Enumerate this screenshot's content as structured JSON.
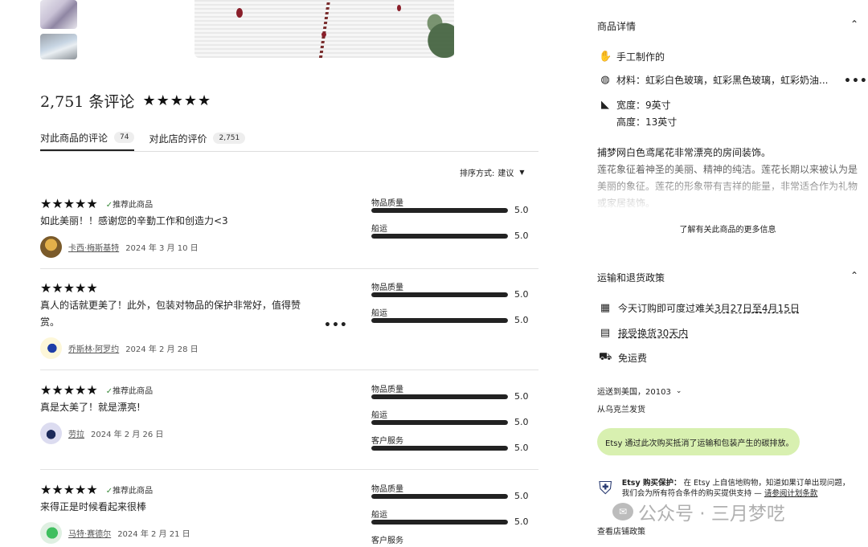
{
  "reviews_header": {
    "count_label": "2,751 条评论",
    "stars": "★★★★★"
  },
  "tabs": [
    {
      "label": "对此商品的评论",
      "count": "74"
    },
    {
      "label": "对此店的评价",
      "count": "2,751"
    }
  ],
  "sort": {
    "label": "排序方式:",
    "value": "建议"
  },
  "rating_labels": {
    "quality": "物品质量",
    "shipping": "船运",
    "service": "客户服务"
  },
  "reviews": [
    {
      "stars": "★★★★★",
      "recommended": "推荐此商品",
      "text": "如此美丽！！感谢您的辛勤工作和创造力<3",
      "author": "卡西·梅斯基特",
      "date": "2024 年 3 月 10 日",
      "ratings": [
        {
          "value": "5.0",
          "fill": 1.0
        },
        {
          "value": "5.0",
          "fill": 1.0
        }
      ]
    },
    {
      "stars": "★★★★★",
      "recommended": "",
      "text": "真人的话就更美了！此外，包装对物品的保护非常好，值得赞赏。",
      "author": "乔斯林·阿罗约",
      "date": "2024 年 2 月 28 日",
      "ratings": [
        {
          "value": "5.0",
          "fill": 1.0
        },
        {
          "value": "5.0",
          "fill": 1.0
        }
      ]
    },
    {
      "stars": "★★★★★",
      "recommended": "推荐此商品",
      "text": "真是太美了！就是漂亮!",
      "author": "劳拉",
      "date": "2024 年 2 月 26 日",
      "ratings": [
        {
          "value": "5.0",
          "fill": 1.0
        },
        {
          "value": "5.0",
          "fill": 1.0
        },
        {
          "value": "5.0",
          "fill": 1.0
        }
      ]
    },
    {
      "stars": "★★★★★",
      "recommended": "推荐此商品",
      "text": "来得正是时候看起来很棒",
      "author": "马特·赛德尔",
      "date": "2024 年 2 月 21 日",
      "ratings": [
        {
          "value": "5.0",
          "fill": 1.0
        },
        {
          "value": "5.0",
          "fill": 1.0
        }
      ]
    }
  ],
  "details": {
    "title": "商品详情",
    "handmade": "手工制作的",
    "materials": "材料：虹彩白色玻璃，虹彩黑色玻璃，虹彩奶油...",
    "width": "宽度：9英寸",
    "height": "高度：13英寸",
    "desc_line1": "捕梦网白色鸢尾花非常漂亮的房间装饰。",
    "desc_line2": "莲花象征着神圣的美丽、精神的纯洁。莲花长期以来被认为是美丽的象征。莲花的形象带有吉祥的能量，非常适合作为礼物或家居装饰。",
    "learn_more": "了解有关此商品的更多信息"
  },
  "shipping": {
    "title": "运输和退货政策",
    "delivery_prefix": "今天订购即可度过难关",
    "delivery_range": "3月27日至4月15日",
    "returns": "接受换货30天内",
    "free_shipping": "免运费",
    "ship_to": "运送到美国，20103",
    "ships_from": "从乌克兰发货",
    "eco": "Etsy 通过此次购买抵消了运输和包装产生的碳排放。",
    "protection_title": "Etsy 购买保护：",
    "protection_text": "在 Etsy 上自信地购物，知道如果订单出现问题，我们会为所有符合条件的购买提供支持 —",
    "protection_link": "请参阅计划条款",
    "policy_link": "查看店铺政策"
  },
  "watermark": "公众号 · 三月梦呓"
}
